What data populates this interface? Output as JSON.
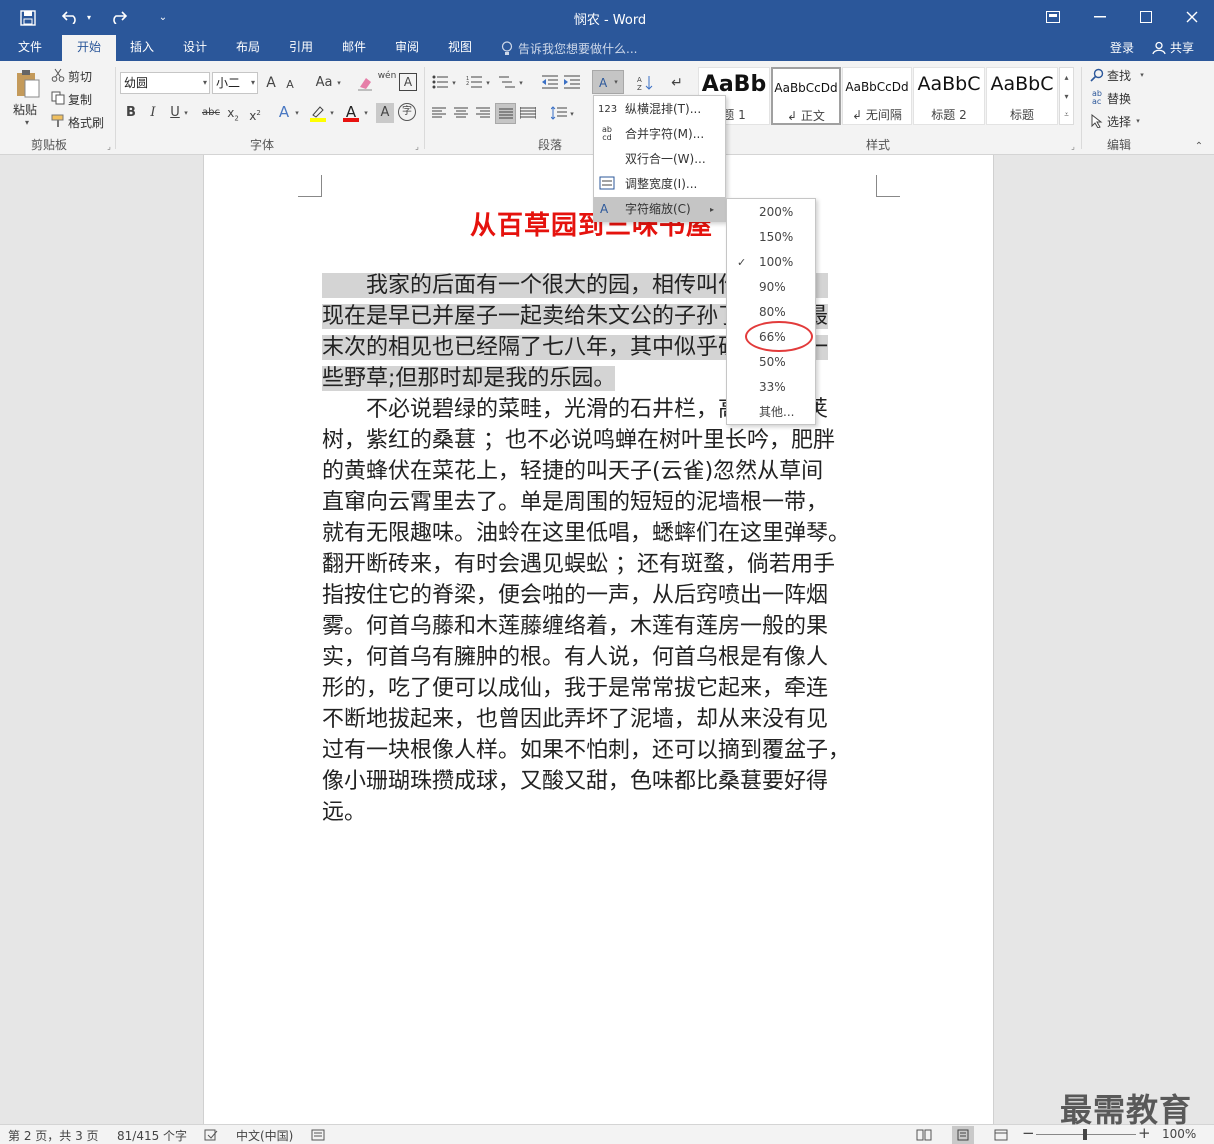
{
  "titlebar": {
    "title": "悯农 - Word",
    "save_icon": "save-icon",
    "undo_icon": "undo-icon",
    "redo_icon": "redo-icon",
    "customize_icon": "customize-qat-icon"
  },
  "tabs": {
    "file": "文件",
    "home": "开始",
    "insert": "插入",
    "design": "设计",
    "layout": "布局",
    "references": "引用",
    "mailings": "邮件",
    "review": "审阅",
    "view": "视图",
    "tell_me": "告诉我您想要做什么...",
    "login": "登录",
    "share": "共享"
  },
  "clipboard": {
    "paste": "粘贴",
    "cut": "剪切",
    "copy": "复制",
    "format_painter": "格式刷",
    "group_label": "剪贴板"
  },
  "font": {
    "font_name": "幼圆",
    "font_size": "小二",
    "grow": "A",
    "shrink": "A",
    "change_case": "Aa",
    "phonetic": "wén",
    "border_char": "A",
    "bold": "B",
    "italic": "I",
    "underline": "U",
    "strike": "abc",
    "subscript": "x",
    "superscript": "x",
    "text_effect": "A",
    "font_color": "A",
    "shading": "A",
    "enclose": "字",
    "group_label": "字体"
  },
  "paragraph": {
    "group_label": "段落"
  },
  "styles": {
    "items": [
      {
        "preview": "AaBb",
        "name": "题 1"
      },
      {
        "preview": "AaBbCcDd",
        "name": "正文"
      },
      {
        "preview": "AaBbCcDd",
        "name": "无间隔"
      },
      {
        "preview": "AaBbC",
        "name": "标题 2"
      },
      {
        "preview": "AaBbC",
        "name": "标题"
      }
    ],
    "group_label": "样式"
  },
  "editing": {
    "find": "查找",
    "replace": "替换",
    "select": "选择",
    "group_label": "编辑"
  },
  "menu": {
    "items": [
      {
        "label": "纵横混排(T)...",
        "icon": "123"
      },
      {
        "label": "合并字符(M)...",
        "icon": "ab cd"
      },
      {
        "label": "双行合一(W)...",
        "icon": ""
      },
      {
        "label": "调整宽度(I)...",
        "icon": "width"
      },
      {
        "label": "字符缩放(C)",
        "icon": "scale"
      }
    ],
    "zoom_items": [
      "200%",
      "150%",
      "100%",
      "90%",
      "80%",
      "66%",
      "50%",
      "33%",
      "其他..."
    ],
    "checked": "100%",
    "highlighted": "66%"
  },
  "document": {
    "title": "从百草园到三味书屋",
    "lines": [
      {
        "text": "　　我家的后面有一个很大的园，相传叫作百草园。",
        "sel": true
      },
      {
        "text": "现在是早已并屋子一起卖给朱文公的子孙了，连那最",
        "sel": true
      },
      {
        "text": "末次的相见也已经隔了七八年，其中似乎确凿只有一",
        "sel": true
      },
      {
        "text": "些野草;但那时却是我的乐园。",
        "sel": true
      },
      {
        "text": "　　不必说碧绿的菜畦，光滑的石井栏，高大的皂荚",
        "sel": false
      },
      {
        "text": "树，紫红的桑葚 ；也不必说鸣蝉在树叶里长吟，肥胖",
        "sel": false
      },
      {
        "text": "的黄蜂伏在菜花上，轻捷的叫天子(云雀)忽然从草间",
        "sel": false
      },
      {
        "text": "直窜向云霄里去了。单是周围的短短的泥墙根一带，",
        "sel": false
      },
      {
        "text": "就有无限趣味。油蛉在这里低唱，蟋蟀们在这里弹琴。",
        "sel": false
      },
      {
        "text": "翻开断砖来，有时会遇见蜈蚣 ；还有斑蝥，倘若用手",
        "sel": false
      },
      {
        "text": "指按住它的脊梁，便会啪的一声，从后窍喷出一阵烟",
        "sel": false
      },
      {
        "text": "雾。何首乌藤和木莲藤缠络着，木莲有莲房一般的果",
        "sel": false
      },
      {
        "text": "实，何首乌有臃肿的根。有人说，何首乌根是有像人",
        "sel": false
      },
      {
        "text": "形的，吃了便可以成仙，我于是常常拔它起来，牵连",
        "sel": false
      },
      {
        "text": "不断地拔起来，也曾因此弄坏了泥墙，却从来没有见",
        "sel": false
      },
      {
        "text": "过有一块根像人样。如果不怕刺，还可以摘到覆盆子，",
        "sel": false
      },
      {
        "text": "像小珊瑚珠攒成球，又酸又甜，色味都比桑葚要好得",
        "sel": false
      },
      {
        "text": "远。",
        "sel": false
      }
    ]
  },
  "status": {
    "page": "第 2 页，共 3 页",
    "words": "81/415 个字",
    "language": "中文(中国)",
    "zoom": "100%"
  },
  "watermark": "最需教育",
  "colors": {
    "accent": "#2b579a",
    "title_red": "#e5120d",
    "circle": "#e23b3b"
  }
}
